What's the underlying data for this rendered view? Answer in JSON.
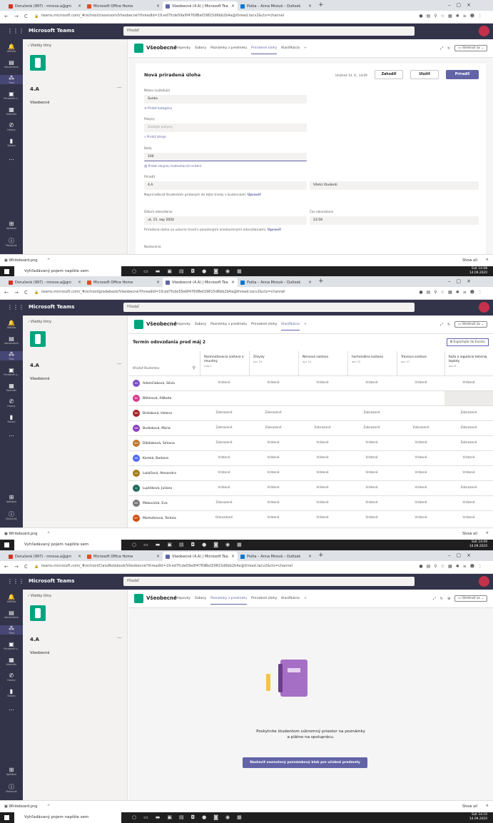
{
  "browser": {
    "tabs1": [
      "Doručené (997) - mnova.a@gm",
      "Microsoft Office Home",
      "Všeobecné (4.A) | Microsoft Tea",
      "Pošta – Anna Mnová – Outlook"
    ],
    "url1": "teams.microsoft.com/_#/school/classroom/Všeobecné?threadId=19:ed7fcde59a9f4769Bef29815d6bb2b4a@thread.tacv2&ctx=channel",
    "url2": "teams.microsoft.com/_#/school/gradebook/Všeobecné?threadId=19:ed7fcde59a9f4769Bef29815d6bb2b4a@thread.tacv2&ctx=channel",
    "url3": "teams.microsoft.com/_#/school/ClassNotebook/Všeobecné?threadId=19:ed7fcde59a9f4769Bef29815d6bb2b4a@thread.tacv2&ctx=channel"
  },
  "app": {
    "title": "Microsoft Teams",
    "search_placeholder": "Hľadať"
  },
  "rail": [
    "Aktivita",
    "Konverzácia",
    "Tímy",
    "Priradené ú...",
    "Kalendár",
    "Hovory",
    "Súbory",
    "...",
    "Aplikácie",
    "Pomocník"
  ],
  "sidebar": {
    "back": "Všetky tímy",
    "team": "4.A",
    "channel": "Všeobecné",
    "more": "···"
  },
  "channel": {
    "name": "Všeobecné",
    "tabs": [
      "Príspevky",
      "Súbory",
      "Poznámky z predmetu",
      "Priradené úlohy",
      "Klasifikácia",
      "+"
    ],
    "meet": "Stretnúť sa"
  },
  "assignment": {
    "title": "Nová priradená úloha",
    "saved": "Uložené 14. 9., 14:09",
    "discard": "Zahodiť",
    "save": "Uložiť",
    "assign": "Priradiť",
    "name_label": "Názov (vyžaduje)",
    "name_value": "Sunka",
    "add_category": "Pridať kategóriu",
    "instructions_label": "Pokyny",
    "instructions_placeholder": "Zadajte pokyny",
    "add_resources": "Pridať zdroje",
    "points_label": "Body",
    "points_value": "100",
    "add_rubric": "Pridať skupinu hodnotiacich kritérií",
    "assign_label": "Priradiť",
    "class_value": "4.A",
    "students_value": "Všetci študenti",
    "assign_note": "Nepriraďovať študentom pridaným do tejto triedy v budúcnosti.",
    "edit": "Upraviť",
    "due_date_label": "Dátum odovzdania",
    "due_date_value": "ut, 15. sep 2020",
    "due_time_label": "Čas odovzdania",
    "due_time_value": "23:59",
    "late_note": "Priradená úloha sa uzavrie hneď s povolenými oneskorenými odovzdaniami.",
    "settings_label": "Nastavenia"
  },
  "grades": {
    "title": "Termín odovzdania pred máj 2",
    "export": "Exportujte do Excelu",
    "search": "Hľadať študentov",
    "columns": [
      {
        "name": "Rozmnožovacia sústava a imunitný",
        "due": "máj 2"
      },
      {
        "name": "Zmysly",
        "due": "apr 29"
      },
      {
        "name": "Nervová sústava",
        "due": "apr 24"
      },
      {
        "name": "hormonálna sústava",
        "due": "apr 22"
      },
      {
        "name": "Tráviaca sústava",
        "due": "apr 17"
      },
      {
        "name": "Koža a regulácia telesnej teploty",
        "due": "apr 8"
      }
    ],
    "rows": [
      {
        "ini": "AS",
        "name": "Adamčiaková, Silvia",
        "color": "#7a4ec7",
        "cells": [
          "Vrátené",
          "Vrátené",
          "Vrátené",
          "Vrátené",
          "Vrátené",
          "Vrátené"
        ]
      },
      {
        "ini": "BA",
        "name": "Bittárová, Alžbeta",
        "color": "#d63c8e",
        "cells": [
          "",
          "",
          "",
          "",
          "",
          ""
        ]
      },
      {
        "ini": "BH",
        "name": "Brdiaková, Helena",
        "color": "#a4262c",
        "cells": [
          "Zobrazené",
          "Zobrazené",
          "",
          "Zobrazené",
          "",
          "Zobrazené"
        ]
      },
      {
        "ini": "BM",
        "name": "Budiaková, Mária",
        "color": "#8a3fbf",
        "cells": [
          "Zobrazené",
          "Zobrazené",
          "Zobrazené",
          "Zobrazené",
          "Zobrazené",
          "Zobrazené"
        ]
      },
      {
        "ini": "DS",
        "name": "Dibdiaková, Simona",
        "color": "#c0762a",
        "cells": [
          "Zobrazené",
          "Vrátené",
          "Vrátené",
          "Vrátené",
          "Vrátené",
          "Zobrazené"
        ]
      },
      {
        "ini": "KB",
        "name": "Koreká, Barbora",
        "color": "#4f6bed",
        "cells": [
          "Vrátené",
          "Vrátené",
          "Vrátené",
          "Vrátené",
          "Vrátené",
          "Vrátené"
        ]
      },
      {
        "ini": "LA",
        "name": "Lukáčová, Alexandra",
        "color": "#a77a1c",
        "cells": [
          "Vrátené",
          "Vrátené",
          "Vrátené",
          "Vrátené",
          "Vrátené",
          "Vrátené"
        ]
      },
      {
        "ini": "LJ",
        "name": "Luptáková, Juliana",
        "color": "#1f6b5a",
        "cells": [
          "Vrátené",
          "Vrátené",
          "Vrátené",
          "Vrátené",
          "Vrátené",
          "Zobrazené"
        ]
      },
      {
        "ini": "ME",
        "name": "Makovická, Eva",
        "color": "#7a7574",
        "cells": [
          "Zobrazené",
          "Vrátené",
          "Vrátené",
          "Vrátené",
          "Vrátené",
          "Vrátené"
        ]
      },
      {
        "ini": "MT",
        "name": "Marhoferová, Terézia",
        "color": "#ca5010",
        "cells": [
          "Odovzdané",
          "Vrátené",
          "Vrátené",
          "Vrátené",
          "Vrátené",
          "Vrátené"
        ]
      }
    ]
  },
  "notebook": {
    "message_line1": "Poskytnite študentom súkromný priestor na poznámky",
    "message_line2": "a plátno na spoluprácu.",
    "button": "Nastaviť onenotový poznámkový blok pre učebné predmety"
  },
  "download": {
    "file": "Whiteboard.png",
    "show_all": "Show all"
  },
  "taskbar": {
    "search": "Vyhľadávaný pojem napíšte sem",
    "lang": "SLK",
    "time1": "14:08",
    "time2": "14:09",
    "time3": "14:10",
    "date": "14.09.2020"
  }
}
